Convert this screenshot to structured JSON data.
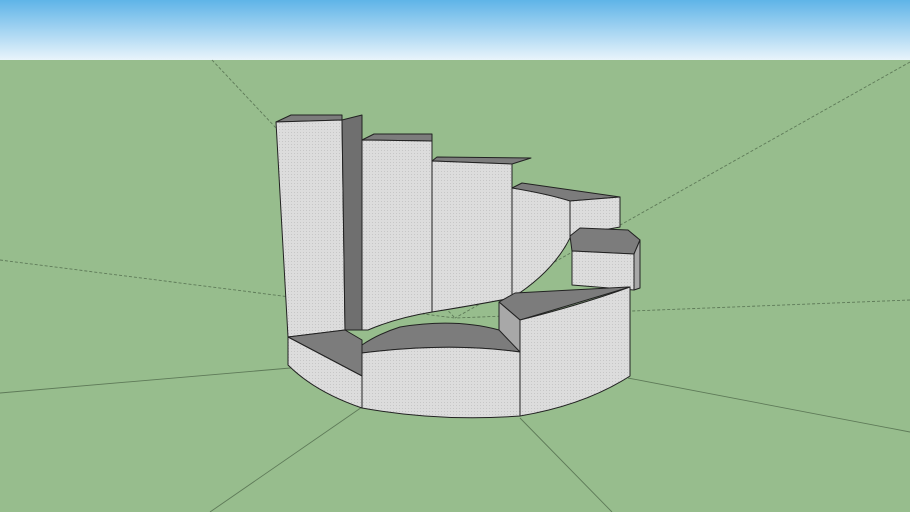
{
  "viewport": {
    "sky_top_color": "#5fb4e8",
    "sky_bottom_color": "#e9f4fb",
    "ground_color": "#97bd8d",
    "axis_line_color": "#5e7a58"
  },
  "model": {
    "light_face_color": "#dadada",
    "mid_face_color": "#a8a8a8",
    "dark_face_color": "#6f6f6f",
    "top_face_color": "#7c7c7c",
    "edge_color": "#222222"
  }
}
